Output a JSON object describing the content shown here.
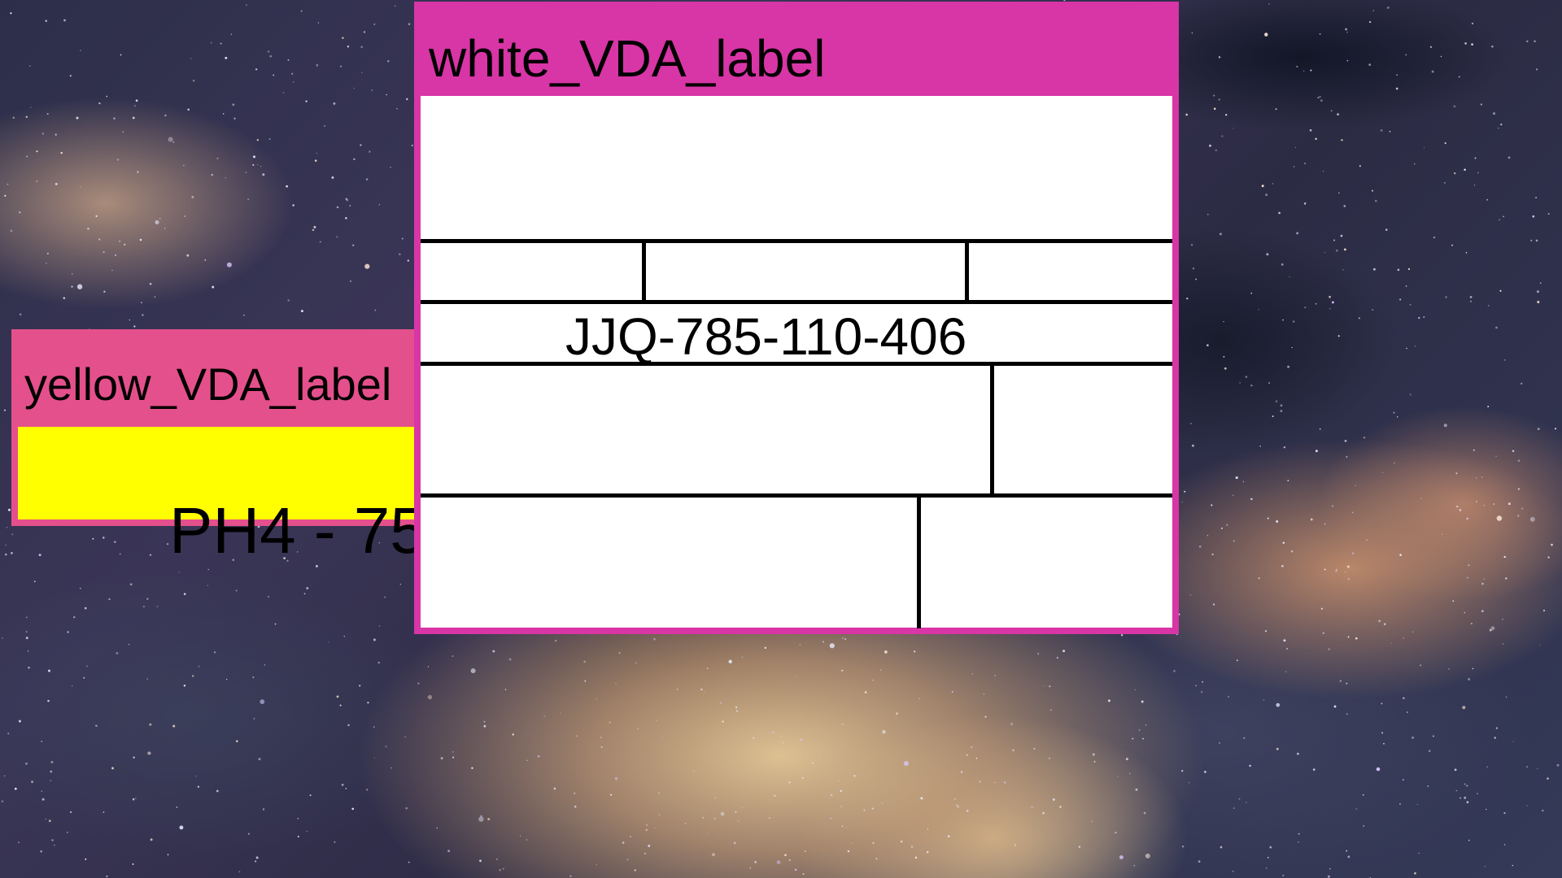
{
  "background": {
    "name": "galaxy-wallpaper"
  },
  "windows": {
    "yellow": {
      "title": "yellow_VDA_label",
      "code": "PH4 - 75",
      "title_color": "#e4508c",
      "body_color": "#ffff00"
    },
    "white": {
      "title": "white_VDA_label",
      "code": "JJQ-785-110-406",
      "title_color": "#d835a6",
      "body_color": "#ffffff"
    }
  }
}
